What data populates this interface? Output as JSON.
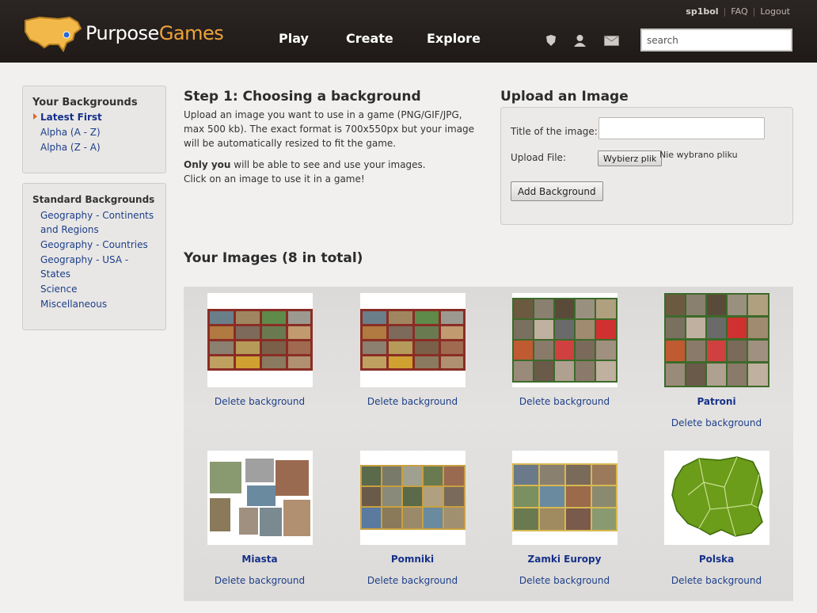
{
  "header": {
    "logo_word_1": "Purpose",
    "logo_word_2": "Games",
    "nav": [
      "Play",
      "Create",
      "Explore"
    ],
    "username": "sp1bol",
    "faq": "FAQ",
    "logout": "Logout",
    "search_placeholder": "search"
  },
  "sidebar": {
    "your_title": "Your Backgrounds",
    "your_items": [
      "Latest First",
      "Alpha (A - Z)",
      "Alpha (Z - A)"
    ],
    "standard_title": "Standard Backgrounds",
    "standard_items": [
      "Geography - Continents",
      "and Regions",
      "Geography - Countries",
      "Geography - USA -",
      "States",
      "Science",
      "Miscellaneous"
    ]
  },
  "step1": {
    "title": "Step 1: Choosing a background",
    "line1": "Upload an image you want to use in a game (PNG/GIF/JPG,",
    "line2": "max 500 kb). The exact format is 700x550px but your image",
    "line3": "will be automatically resized to fit the game.",
    "bold": "Only you",
    "line4": " will be able to see and use your images.",
    "line5": "Click on an image to use it in a game!"
  },
  "upload": {
    "title": "Upload an Image",
    "title_label": "Title of the image:",
    "file_label": "Upload File:",
    "file_button": "Wybierz plik",
    "file_status": "Nie wybrano pliku",
    "add_button": "Add Background"
  },
  "gallery": {
    "title": "Your Images (8 in total)",
    "delete_label": "Delete background",
    "images": [
      {
        "name": ""
      },
      {
        "name": ""
      },
      {
        "name": ""
      },
      {
        "name": "Patroni"
      },
      {
        "name": "Miasta"
      },
      {
        "name": "Pomniki"
      },
      {
        "name": "Zamki Europy"
      },
      {
        "name": "Polska"
      }
    ]
  },
  "colors": {
    "header_bg": "#231e1c",
    "logo_accent": "#f0a33a",
    "link": "#1c3f8a",
    "map_green": "#6b9c1a"
  }
}
